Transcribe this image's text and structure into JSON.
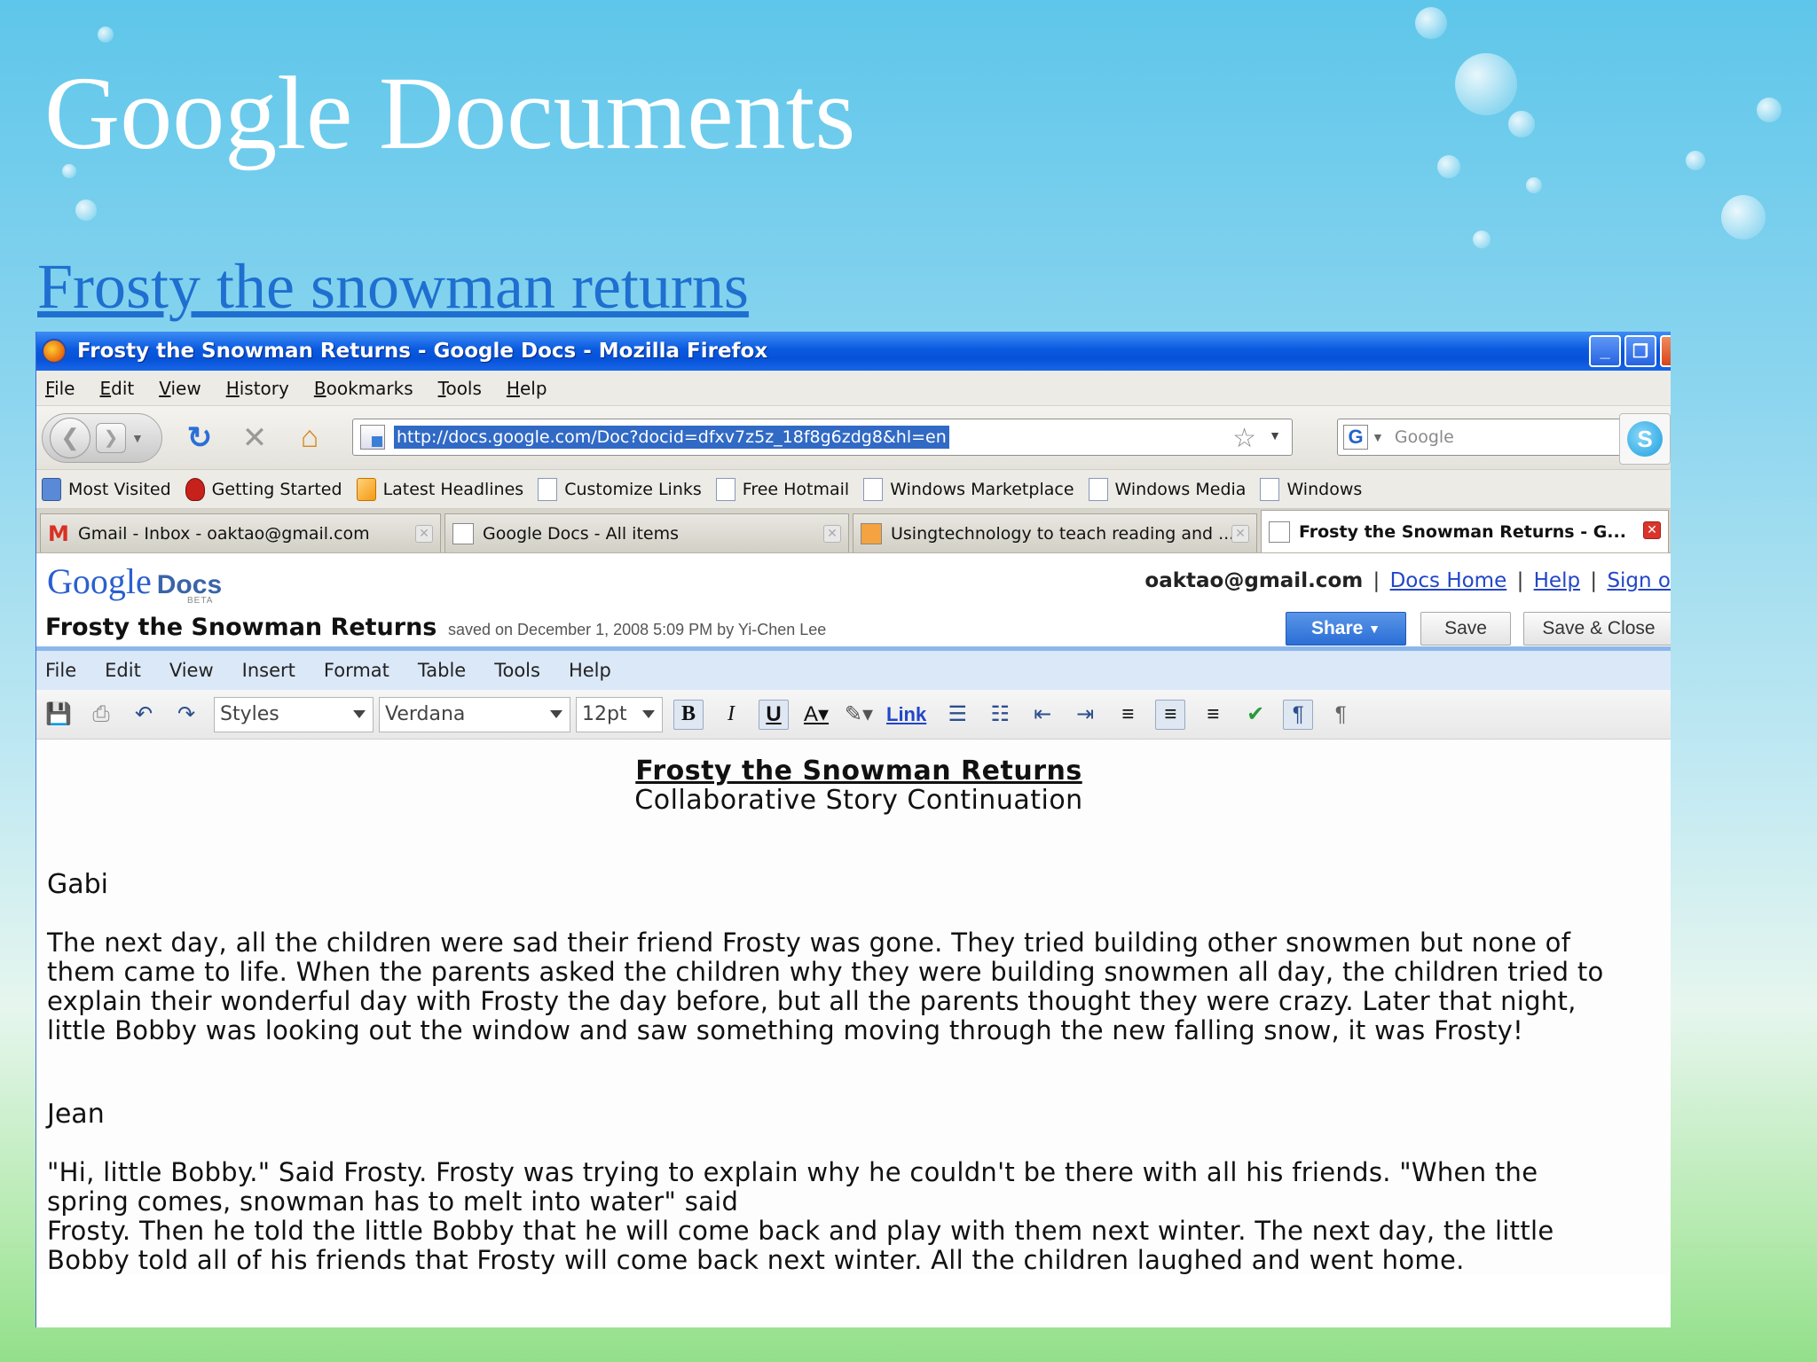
{
  "slide": {
    "title": "Google Documents",
    "link_text": "Frosty the snowman returns"
  },
  "browser": {
    "window_title": "Frosty the Snowman Returns - Google Docs - Mozilla Firefox",
    "menu": [
      "File",
      "Edit",
      "View",
      "History",
      "Bookmarks",
      "Tools",
      "Help"
    ],
    "url": "http://docs.google.com/Doc?docid=dfxv7z5z_18f8g6zdg8&hl=en",
    "search_placeholder": "Google",
    "bookmarks": [
      "Most Visited",
      "Getting Started",
      "Latest Headlines",
      "Customize Links",
      "Free Hotmail",
      "Windows Marketplace",
      "Windows Media",
      "Windows"
    ],
    "tabs": [
      {
        "label": "Gmail - Inbox - oaktao@gmail.com"
      },
      {
        "label": "Google Docs - All items"
      },
      {
        "label": "Usingtechnology to teach reading and ..."
      },
      {
        "label": "Frosty the Snowman Returns - G..."
      }
    ]
  },
  "docs": {
    "logo_google": "Google",
    "logo_docs": "Docs",
    "beta": "BETA",
    "user_email": "oaktao@gmail.com",
    "links": [
      "Docs Home",
      "Help",
      "Sign o"
    ],
    "doc_title": "Frosty the Snowman Returns",
    "saved_info": "saved on December 1, 2008 5:09 PM by Yi-Chen Lee",
    "share_label": "Share",
    "save_label": "Save",
    "save_close_label": "Save & Close",
    "menu": [
      "File",
      "Edit",
      "View",
      "Insert",
      "Format",
      "Table",
      "Tools",
      "Help"
    ],
    "toolbar": {
      "styles": "Styles",
      "font": "Verdana",
      "size": "12pt",
      "link": "Link"
    }
  },
  "document": {
    "heading": "Frosty the Snowman Returns",
    "subheading": "Collaborative Story Continuation",
    "sections": [
      {
        "author": "Gabi",
        "lines": [
          "The next day, all the children were sad their friend Frosty was gone.  They tried building other snowmen but none of",
          "them came to life.  When the parents asked the children why they were building snowmen all day, the children tried to",
          "explain their wonderful day with Frosty the day before, but all the parents thought they were crazy.  Later that night,",
          "little Bobby was looking out the window and saw something moving through the new falling snow, it was Frosty!"
        ]
      },
      {
        "author": "Jean",
        "lines": [
          "\"Hi, little Bobby.\" Said Frosty. Frosty was trying to explain why he couldn't be there with all his friends. \"When the",
          "spring comes, snowman has to melt into water\" said",
          "Frosty. Then he told the little Bobby that he will come back and play with them next winter. The next day, the little",
          "Bobby told all of his friends that Frosty will come back next winter. All the children laughed and went home."
        ]
      }
    ]
  }
}
